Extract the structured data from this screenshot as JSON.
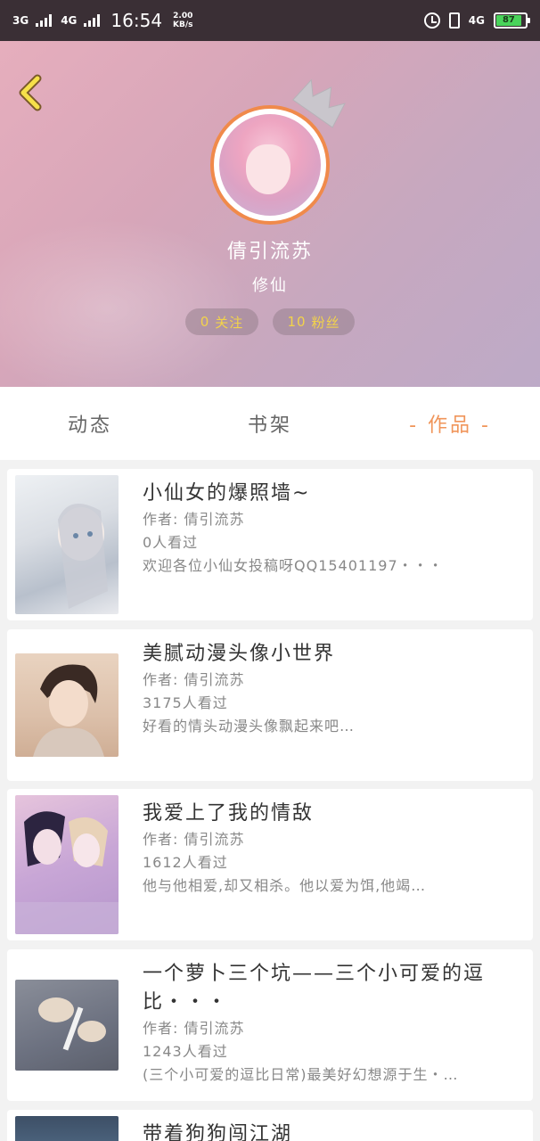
{
  "status_bar": {
    "net1": "3G",
    "net2": "4G",
    "time": "16:54",
    "speed_value": "2.00",
    "speed_unit": "KB/s",
    "net3": "4G",
    "battery": "87"
  },
  "profile": {
    "name": "倩引流苏",
    "rank": "修仙",
    "follow_count": "0",
    "follow_label": "关注",
    "fans_count": "10",
    "fans_label": "粉丝",
    "accent_color": "#f0955a"
  },
  "tabs": [
    {
      "label": "动态",
      "active": false
    },
    {
      "label": "书架",
      "active": false
    },
    {
      "label": "- 作品 -",
      "active": true
    }
  ],
  "works": [
    {
      "title": "小仙女的爆照墙~",
      "author": "作者: 倩引流苏",
      "views": "0人看过",
      "desc": "欢迎各位小仙女投稿呀QQ15401197・・・",
      "cover_icon": "anime-girl-cover"
    },
    {
      "title": "美腻动漫头像小世界",
      "author": "作者: 倩引流苏",
      "views": "3175人看过",
      "desc": "好看的情头动漫头像飘起来吧…",
      "cover_icon": "anime-boy-cover"
    },
    {
      "title": "我爱上了我的情敌",
      "author": "作者: 倩引流苏",
      "views": "1612人看过",
      "desc": "他与他相爱,却又相杀。他以爱为饵,他竭…",
      "cover_icon": "anime-couple-cover"
    },
    {
      "title": "一个萝卜三个坑——三个小可爱的逗比・・・",
      "author": "作者: 倩引流苏",
      "views": "1243人看过",
      "desc": "(三个小可爱的逗比日常)最美好幻想源于生・…",
      "cover_icon": "cat-paw-cover"
    },
    {
      "title": "带着狗狗闯江湖",
      "cover_icon": "dog-cover"
    }
  ]
}
